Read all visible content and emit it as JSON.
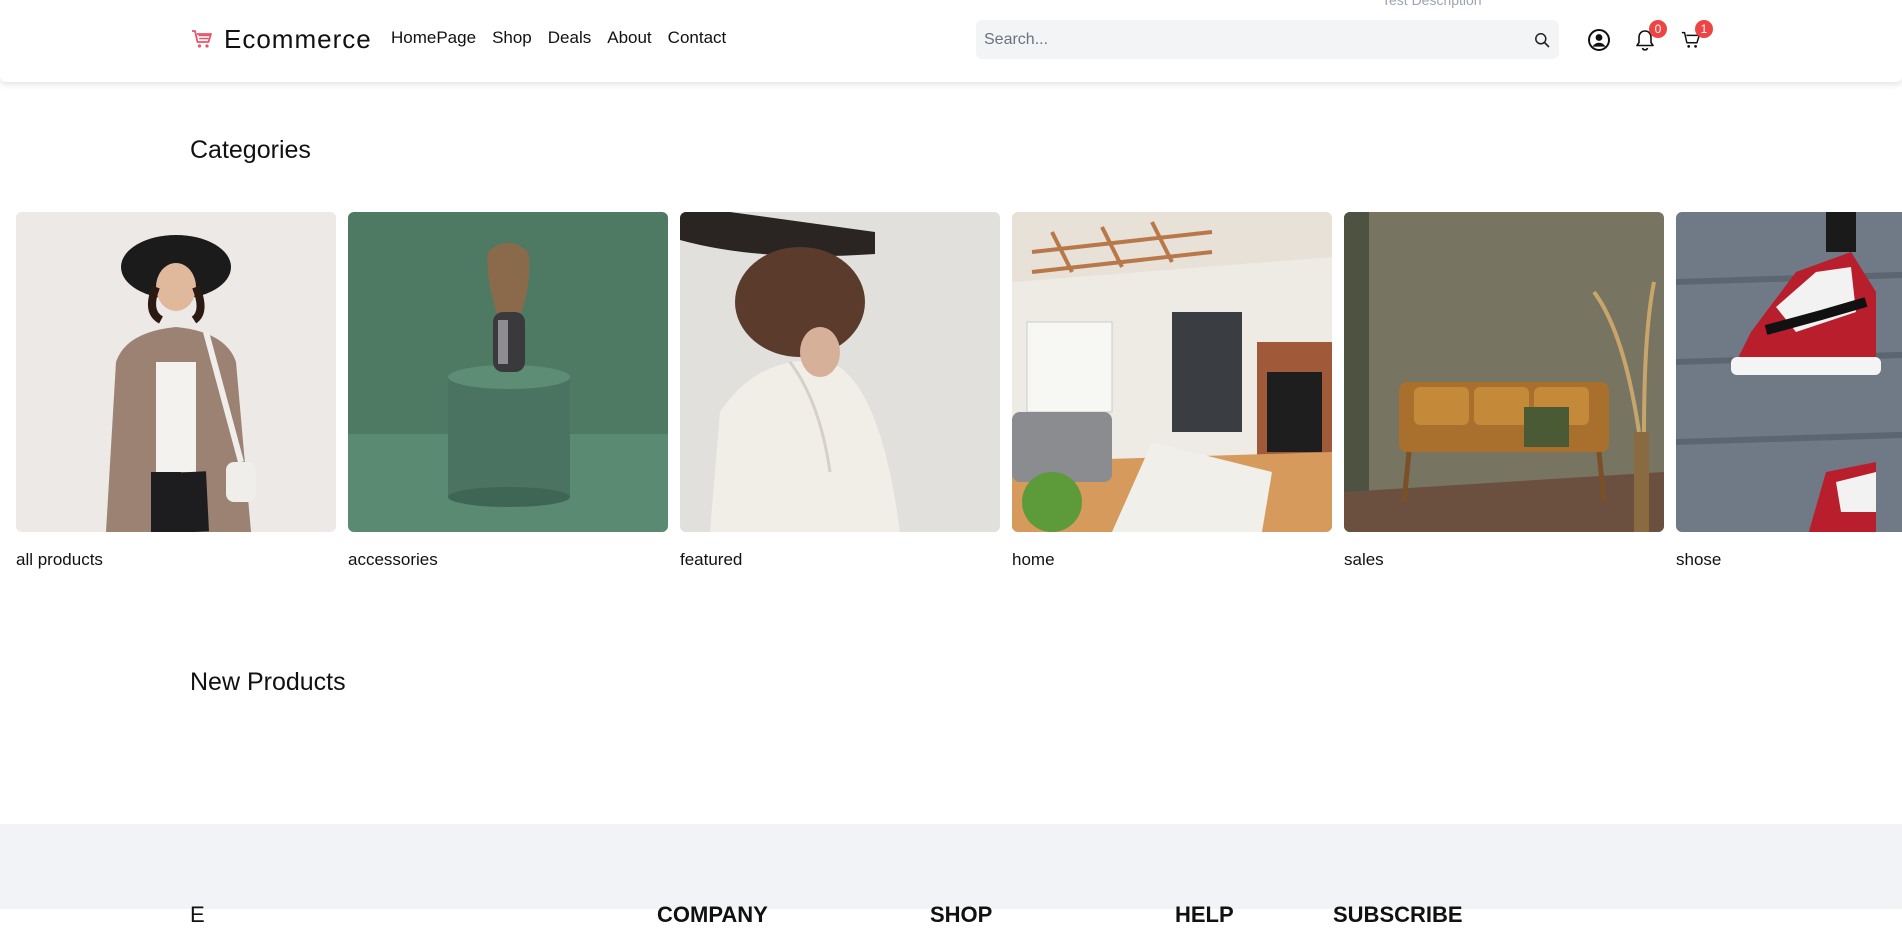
{
  "header": {
    "ghost_text": "Test Description",
    "brand": "Ecommerce",
    "nav": [
      "HomePage",
      "Shop",
      "Deals",
      "About",
      "Contact"
    ],
    "search_placeholder": "Search...",
    "notification_count": "0",
    "cart_count": "1",
    "accent_color": "#ef4444"
  },
  "categories": {
    "title": "Categories",
    "items": [
      {
        "label": "all products"
      },
      {
        "label": "accessories"
      },
      {
        "label": "featured"
      },
      {
        "label": "home"
      },
      {
        "label": "sales"
      },
      {
        "label": "shose"
      }
    ]
  },
  "new_products": {
    "title": "New Products"
  },
  "footer": {
    "brand": "E",
    "columns": [
      "COMPANY",
      "SHOP",
      "HELP",
      "SUBSCRIBE"
    ]
  }
}
